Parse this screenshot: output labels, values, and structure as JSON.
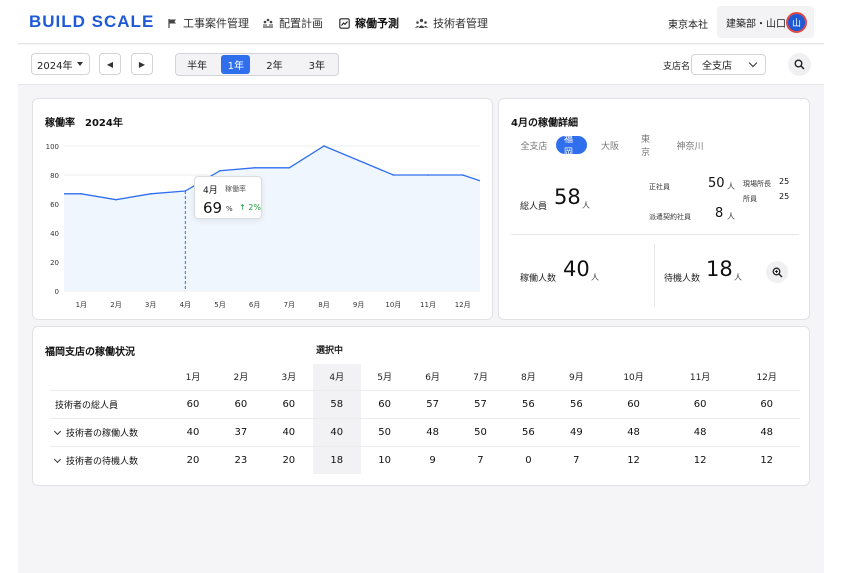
{
  "header": {
    "logo": "BUILD SCALE",
    "nav": [
      {
        "label": "工事案件管理",
        "icon": "flag-icon"
      },
      {
        "label": "配置計画",
        "icon": "people-placement-icon"
      },
      {
        "label": "稼働予測",
        "icon": "chart-icon",
        "active": true
      },
      {
        "label": "技術者管理",
        "icon": "team-icon"
      }
    ],
    "office": "東京本社",
    "user": "建築部・山口",
    "avatar_char": "山"
  },
  "toolbar": {
    "year": "2024年",
    "ranges": [
      "半年",
      "1年",
      "2年",
      "3年"
    ],
    "selected_range": "1年",
    "branch_label": "支店名",
    "branch_value": "全支店"
  },
  "chart_card": {
    "title": "稼働率　2024年",
    "tooltip": {
      "month": "4月",
      "label": "稼働率",
      "value": "69",
      "unit": "%",
      "delta": "↑ 2%"
    }
  },
  "chart_data": {
    "type": "area",
    "title": "稼働率　2024年",
    "categories": [
      "1月",
      "2月",
      "3月",
      "4月",
      "5月",
      "6月",
      "7月",
      "8月",
      "9月",
      "10月",
      "11月",
      "12月"
    ],
    "values": [
      67,
      63,
      67,
      69,
      83,
      85,
      85,
      100,
      90,
      80,
      80,
      80
    ],
    "start_value": 67,
    "end_value": 76,
    "ylim": [
      0,
      100
    ],
    "yticks": [
      "0",
      "20",
      "40",
      "60",
      "80",
      "100"
    ],
    "highlight": "4月",
    "grid": true,
    "color": "#2f6fee",
    "fill": "#f0f6fd"
  },
  "detail": {
    "title": "4月の稼働詳細",
    "tabs": [
      "全支店",
      "福岡",
      "大阪",
      "東京",
      "神奈川"
    ],
    "active_tab": "福岡",
    "total_label": "総人員",
    "total_value": "58",
    "unit": "人",
    "regular_label": "正社員",
    "regular_value": "50",
    "dispatch_label": "派遣契約社員",
    "dispatch_value": "8",
    "site_manager_label": "現場所長",
    "site_manager_value": "25",
    "staff_label": "所員",
    "staff_value": "25",
    "working_label": "稼働人数",
    "working_value": "40",
    "waiting_label": "待機人数",
    "waiting_value": "18"
  },
  "status": {
    "title": "福岡支店の稼働状況",
    "selected_label": "選択中",
    "months": [
      "1月",
      "2月",
      "3月",
      "4月",
      "5月",
      "6月",
      "7月",
      "8月",
      "9月",
      "10月",
      "11月",
      "12月"
    ],
    "selected_index": 3,
    "rows": [
      {
        "label": "技術者の総人員",
        "expand": false,
        "values": [
          "60",
          "60",
          "60",
          "58",
          "60",
          "57",
          "57",
          "56",
          "56",
          "60",
          "60",
          "60"
        ]
      },
      {
        "label": "技術者の稼働人数",
        "expand": true,
        "values": [
          "40",
          "37",
          "40",
          "40",
          "50",
          "48",
          "50",
          "56",
          "49",
          "48",
          "48",
          "48"
        ]
      },
      {
        "label": "技術者の待機人数",
        "expand": true,
        "values": [
          "20",
          "23",
          "20",
          "18",
          "10",
          "9",
          "7",
          "0",
          "7",
          "12",
          "12",
          "12"
        ]
      }
    ]
  }
}
